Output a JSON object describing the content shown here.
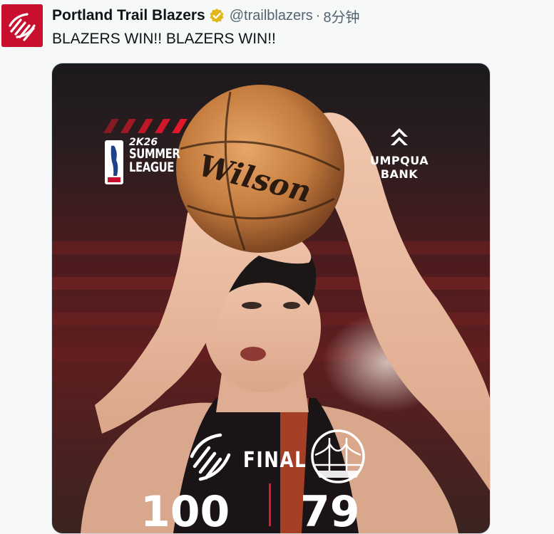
{
  "author": {
    "display_name": "Portland Trail Blazers",
    "handle": "@trailblazers",
    "separator": "·",
    "time": "8分钟",
    "avatar_icon": "trail-blazers-pinwheel-icon",
    "verified_icon": "verified-badge-icon"
  },
  "tweet": {
    "text": "BLAZERS WIN!! BLAZERS WIN!!"
  },
  "media": {
    "league": {
      "line1": "2K26",
      "line2": "SUMMER",
      "line3": "LEAGUE"
    },
    "sponsor": {
      "line1": "UMPQUA",
      "line2": "BANK"
    },
    "status": "FINAL",
    "home_score": "100",
    "away_score": "79",
    "home_logo": "trail-blazers-pinwheel-icon",
    "away_logo": "golden-state-bridge-icon"
  },
  "colors": {
    "brand_red": "#c8102e",
    "verified_gold": "#e2b719",
    "text_secondary": "#536471",
    "divider_red": "#e4172b"
  }
}
